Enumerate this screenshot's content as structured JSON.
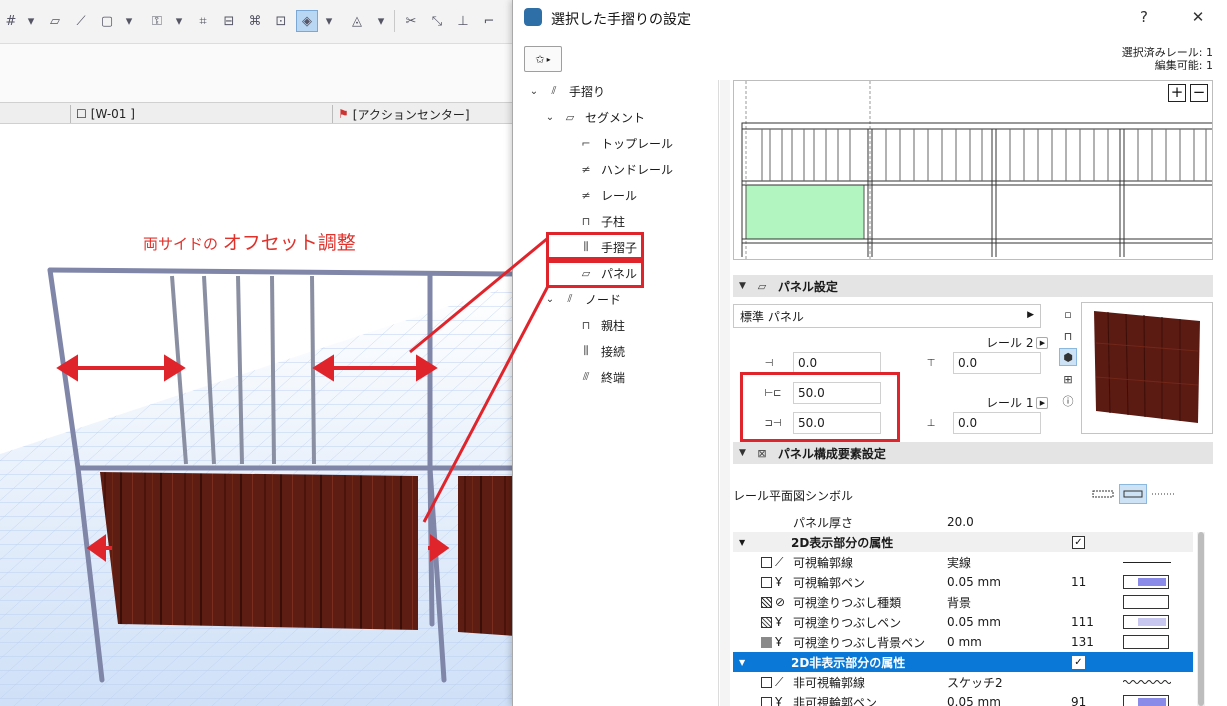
{
  "background_app": {
    "view_tabs": [
      {
        "label": "[W-01 ]"
      },
      {
        "label": "[アクションセンター]"
      }
    ],
    "annotation": {
      "prefix": "両サイドの",
      "emphasis": "オフセット調整"
    }
  },
  "dialog": {
    "title": "選択した手摺りの設定",
    "help_label": "?",
    "close_label": "✕",
    "selection_info": {
      "line1": "選択済みレール: 1",
      "line2": "編集可能: 1"
    },
    "tree": [
      {
        "label": "手摺り",
        "level": 0,
        "expanded": true
      },
      {
        "label": "セグメント",
        "level": 1,
        "expanded": true
      },
      {
        "label": "トップレール",
        "level": 2
      },
      {
        "label": "ハンドレール",
        "level": 2
      },
      {
        "label": "レール",
        "level": 2
      },
      {
        "label": "子柱",
        "level": 2
      },
      {
        "label": "手摺子",
        "level": 2
      },
      {
        "label": "パネル",
        "level": 2,
        "selected": true
      },
      {
        "label": "ノード",
        "level": 1,
        "expanded": true
      },
      {
        "label": "親柱",
        "level": 2
      },
      {
        "label": "接続",
        "level": 2
      },
      {
        "label": "終端",
        "level": 2
      }
    ],
    "zoom_in_label": "+",
    "zoom_out_label": "−",
    "panel_settings": {
      "header": "パネル設定",
      "type_value": "標準 パネル",
      "top_offset": "0.0",
      "left_offset": "50.0",
      "right_offset": "50.0",
      "rail2_label": "レール 2",
      "rail2_value": "0.0",
      "rail1_label": "レール 1",
      "rail1_value": "0.0"
    },
    "component_settings": {
      "header": "パネル構成要素設定",
      "plan_symbol_label": "レール平面図シンボル",
      "rows": [
        {
          "name": "パネル厚さ",
          "value": "20.0",
          "kind": "plain"
        },
        {
          "name": "2D表示部分の属性",
          "kind": "header",
          "checked": true
        },
        {
          "name": "可視輪郭線",
          "value": "実線",
          "kind": "line"
        },
        {
          "name": "可視輪郭ペン",
          "value": "0.05 mm",
          "num": "11",
          "kind": "pen",
          "color": "#8a8ae8"
        },
        {
          "name": "可視塗りつぶし種類",
          "value": "背景",
          "kind": "fill"
        },
        {
          "name": "可視塗りつぶしペン",
          "value": "0.05 mm",
          "num": "111",
          "kind": "pen",
          "color": "#c7c7f0"
        },
        {
          "name": "可視塗りつぶし背景ペン",
          "value": "0 mm",
          "num": "131",
          "kind": "swatch"
        },
        {
          "name": "2D非表示部分の属性",
          "kind": "header-sel",
          "checked": true
        },
        {
          "name": "非可視輪郭線",
          "value": "スケッチ2",
          "kind": "wave"
        },
        {
          "name": "非可視輪郭ペン",
          "value": "0.05 mm",
          "num": "91",
          "kind": "pen",
          "color": "#8a8ae8"
        }
      ]
    }
  },
  "colors": {
    "highlight_red": "#e0242b",
    "selection_blue": "#0a78d6",
    "tree_selection": "#cce4f7",
    "wood": "#5b1a12"
  }
}
